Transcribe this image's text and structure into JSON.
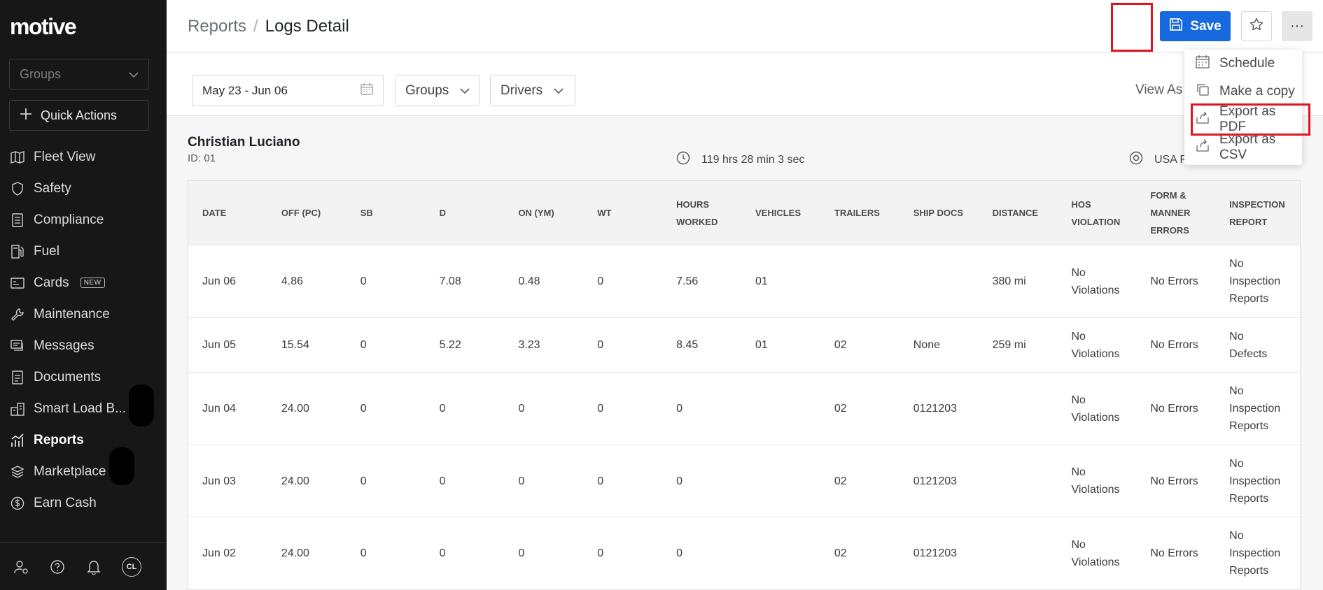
{
  "sidebar": {
    "logo": "motive",
    "groups_placeholder": "Groups",
    "quick_actions": "Quick Actions",
    "items": [
      {
        "label": "Fleet View",
        "icon": "map-icon"
      },
      {
        "label": "Safety",
        "icon": "shield-icon"
      },
      {
        "label": "Compliance",
        "icon": "document-list-icon"
      },
      {
        "label": "Fuel",
        "icon": "fuel-pump-icon"
      },
      {
        "label": "Cards",
        "icon": "card-icon",
        "badge": "NEW"
      },
      {
        "label": "Maintenance",
        "icon": "wrench-icon"
      },
      {
        "label": "Messages",
        "icon": "chat-icon"
      },
      {
        "label": "Documents",
        "icon": "document-icon"
      },
      {
        "label": "Smart Load B...",
        "icon": "load-board-icon"
      },
      {
        "label": "Reports",
        "icon": "chart-icon",
        "active": true
      },
      {
        "label": "Marketplace",
        "icon": "layers-icon"
      },
      {
        "label": "Earn Cash",
        "icon": "dollar-icon"
      }
    ],
    "footer": {
      "avatar_initials": "CL"
    }
  },
  "header": {
    "breadcrumb_parent": "Reports",
    "breadcrumb_sep": "/",
    "title": "Logs Detail",
    "save_label": "Save"
  },
  "filters": {
    "date_range": "May 23 - Jun 06",
    "groups": "Groups",
    "drivers": "Drivers",
    "view_as": "View As"
  },
  "driver": {
    "name": "Christian Luciano",
    "id": "ID: 01",
    "hours_worked": "119 hrs 28 min 3 sec",
    "region": "USA P"
  },
  "menu": {
    "items": [
      {
        "label": "Schedule",
        "icon": "calendar-icon"
      },
      {
        "label": "Make a copy",
        "icon": "copy-icon"
      },
      {
        "label": "Export as PDF",
        "icon": "export-icon"
      },
      {
        "label": "Export as CSV",
        "icon": "export-icon"
      }
    ]
  },
  "table": {
    "columns": [
      [
        "DATE"
      ],
      [
        "OFF (PC)"
      ],
      [
        "SB"
      ],
      [
        "D"
      ],
      [
        "ON (YM)"
      ],
      [
        "WT"
      ],
      [
        "HOURS",
        "WORKED"
      ],
      [
        "VEHICLES"
      ],
      [
        "TRAILERS"
      ],
      [
        "SHIP DOCS"
      ],
      [
        "DISTANCE"
      ],
      [
        "HOS",
        "VIOLATION"
      ],
      [
        "FORM &",
        "MANNER",
        "ERRORS"
      ],
      [
        "INSPECTION",
        "REPORT"
      ]
    ],
    "rows": [
      {
        "height": 104,
        "cells": [
          [
            "Jun 06"
          ],
          [
            "4.86"
          ],
          [
            "0"
          ],
          [
            "7.08"
          ],
          [
            "0.48"
          ],
          [
            "0"
          ],
          [
            "7.56"
          ],
          [
            "01"
          ],
          [
            ""
          ],
          [
            ""
          ],
          [
            "380 mi"
          ],
          [
            "No",
            "Violations"
          ],
          [
            "No Errors"
          ],
          [
            "No",
            "Inspection",
            "Reports"
          ]
        ]
      },
      {
        "height": 78,
        "cells": [
          [
            "Jun 05"
          ],
          [
            "15.54"
          ],
          [
            "0"
          ],
          [
            "5.22"
          ],
          [
            "3.23"
          ],
          [
            "0"
          ],
          [
            "8.45"
          ],
          [
            "01"
          ],
          [
            "02"
          ],
          [
            "None"
          ],
          [
            "259 mi"
          ],
          [
            "No",
            "Violations"
          ],
          [
            "No Errors"
          ],
          [
            "No",
            "Defects"
          ]
        ]
      },
      {
        "height": 104,
        "cells": [
          [
            "Jun 04"
          ],
          [
            "24.00"
          ],
          [
            "0"
          ],
          [
            "0"
          ],
          [
            "0"
          ],
          [
            "0"
          ],
          [
            "0"
          ],
          [
            ""
          ],
          [
            "02"
          ],
          [
            "0121203"
          ],
          [
            ""
          ],
          [
            "No",
            "Violations"
          ],
          [
            "No Errors"
          ],
          [
            "No",
            "Inspection",
            "Reports"
          ]
        ]
      },
      {
        "height": 103,
        "cells": [
          [
            "Jun 03"
          ],
          [
            "24.00"
          ],
          [
            "0"
          ],
          [
            "0"
          ],
          [
            "0"
          ],
          [
            "0"
          ],
          [
            "0"
          ],
          [
            ""
          ],
          [
            "02"
          ],
          [
            "0121203"
          ],
          [
            ""
          ],
          [
            "No",
            "Violations"
          ],
          [
            "No Errors"
          ],
          [
            "No",
            "Inspection",
            "Reports"
          ]
        ]
      },
      {
        "height": 104,
        "cells": [
          [
            "Jun 02"
          ],
          [
            "24.00"
          ],
          [
            "0"
          ],
          [
            "0"
          ],
          [
            "0"
          ],
          [
            "0"
          ],
          [
            "0"
          ],
          [
            ""
          ],
          [
            "02"
          ],
          [
            "0121203"
          ],
          [
            ""
          ],
          [
            "No",
            "Violations"
          ],
          [
            "No Errors"
          ],
          [
            "No",
            "Inspection",
            "Reports"
          ]
        ]
      }
    ]
  },
  "colors": {
    "accent": "#1769e0",
    "highlight": "#e0141e",
    "sidebar_bg": "#171717"
  }
}
